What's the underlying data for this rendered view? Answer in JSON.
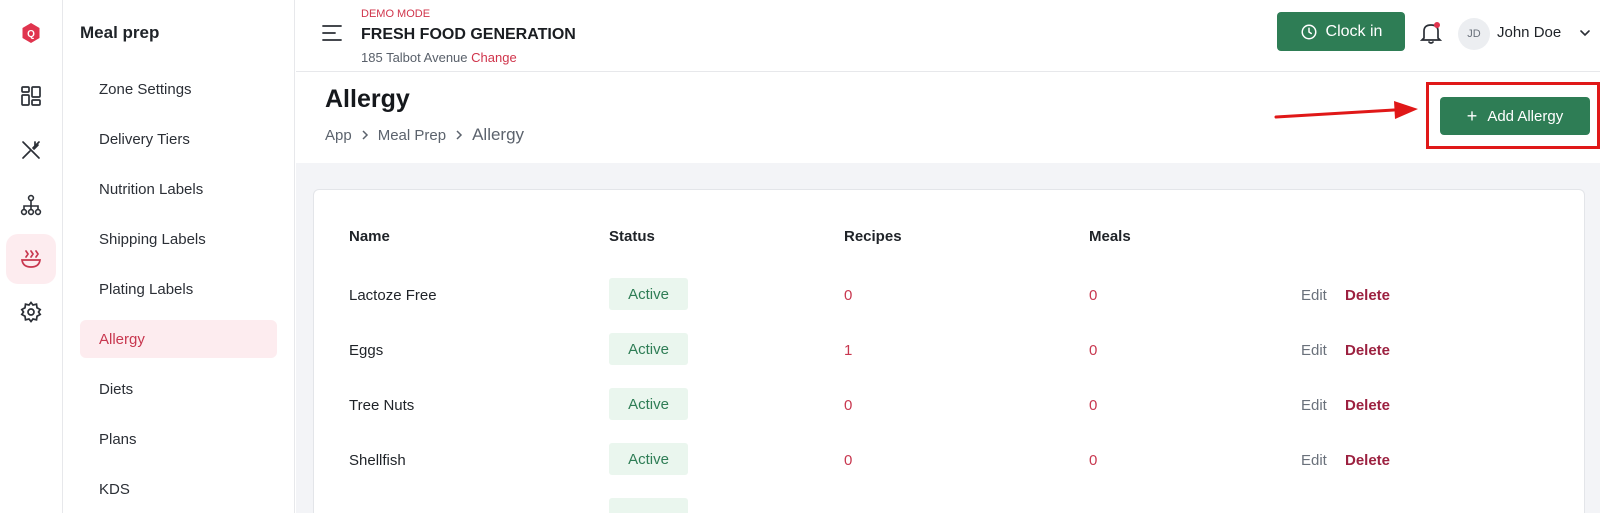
{
  "app": {
    "demo_label": "DEMO MODE",
    "brand_name": "FRESH FOOD GENERATION",
    "address": "185 Talbot Avenue",
    "change_label": "Change",
    "logo_letter": "Q"
  },
  "header": {
    "clock_in_label": "Clock in",
    "user_initials": "JD",
    "user_name": "John Doe"
  },
  "rail": {
    "icons": [
      "dashboard-icon",
      "utensils-icon",
      "org-chart-icon",
      "meal-prep-icon",
      "settings-icon"
    ],
    "active": "meal-prep-icon"
  },
  "sidebar": {
    "title": "Meal prep",
    "items": [
      {
        "label": "Zone Settings"
      },
      {
        "label": "Delivery Tiers"
      },
      {
        "label": "Nutrition Labels"
      },
      {
        "label": "Shipping Labels"
      },
      {
        "label": "Plating Labels"
      },
      {
        "label": "Allergy"
      },
      {
        "label": "Diets"
      },
      {
        "label": "Plans"
      },
      {
        "label": "KDS"
      }
    ],
    "active_label": "Allergy"
  },
  "page": {
    "title": "Allergy",
    "breadcrumb": [
      "App",
      "Meal Prep",
      "Allergy"
    ],
    "add_button_label": "Add Allergy"
  },
  "table": {
    "columns": [
      "Name",
      "Status",
      "Recipes",
      "Meals"
    ],
    "rows": [
      {
        "name": "Lactoze Free",
        "status": "Active",
        "recipes": "0",
        "meals": "0"
      },
      {
        "name": "Eggs",
        "status": "Active",
        "recipes": "1",
        "meals": "0"
      },
      {
        "name": "Tree Nuts",
        "status": "Active",
        "recipes": "0",
        "meals": "0"
      },
      {
        "name": "Shellfish",
        "status": "Active",
        "recipes": "0",
        "meals": "0"
      }
    ],
    "edit_label": "Edit",
    "delete_label": "Delete"
  },
  "colors": {
    "accent_green": "#2e7d55",
    "accent_red": "#c8374f",
    "annotation_red": "#e01818"
  }
}
